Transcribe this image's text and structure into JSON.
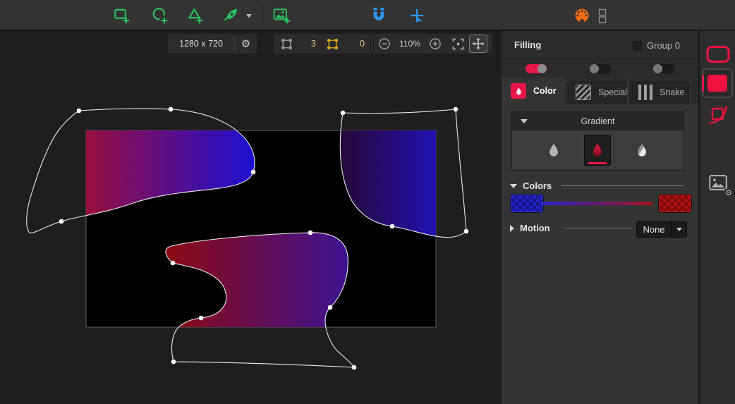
{
  "topbar": {
    "tools": [
      {
        "name": "add-rectangle"
      },
      {
        "name": "add-ellipse"
      },
      {
        "name": "add-polygon"
      },
      {
        "name": "draw-bezier",
        "has_dropdown": true
      },
      {
        "name": "add-image"
      },
      {
        "name": "snap-magnet"
      },
      {
        "name": "add-node"
      },
      {
        "name": "palette"
      },
      {
        "name": "layout-toggle"
      }
    ]
  },
  "canvas_toolbar": {
    "size_label": "1280 x 720",
    "nodes_count": "3",
    "points_count": "0",
    "zoom": "110%",
    "active_tool": "pan"
  },
  "filling_panel": {
    "title": "Filling",
    "group_checkbox_label": "Group 0",
    "group_checked": false,
    "toggles": [
      {
        "state": "on"
      },
      {
        "state": "off"
      },
      {
        "state": "off"
      }
    ],
    "tabs": [
      {
        "label": "Color",
        "active": true
      },
      {
        "label": "Special",
        "active": false
      },
      {
        "label": "Snake",
        "active": false
      }
    ],
    "gradient_section": {
      "title": "Gradient",
      "options": [
        "solid",
        "gradient",
        "split"
      ],
      "selected": "gradient"
    },
    "colors_section": {
      "title": "Colors",
      "start_color": "#2121c4",
      "end_color": "#ad1010"
    },
    "motion_section": {
      "title": "Motion",
      "value": "None"
    }
  },
  "right_toolbar": {
    "items": [
      "stroke-style",
      "fill-style",
      "shape-motion",
      "image-settings"
    ],
    "selected": "fill-style"
  },
  "scene": {
    "artboard": "#000000",
    "gradients": {
      "shape1": {
        "from": "#9a0f3a",
        "to": "#180fd6"
      },
      "shape2": {
        "from": "#26061e",
        "to": "#2113cb"
      },
      "shape3": {
        "from": "#8b0a12",
        "to": "#3a1396"
      }
    }
  },
  "theme": {
    "accent_red": "#e8174a",
    "icon_green": "#2dc05f",
    "icon_blue": "#2b97f5",
    "icon_orange": "#ef6a10"
  }
}
